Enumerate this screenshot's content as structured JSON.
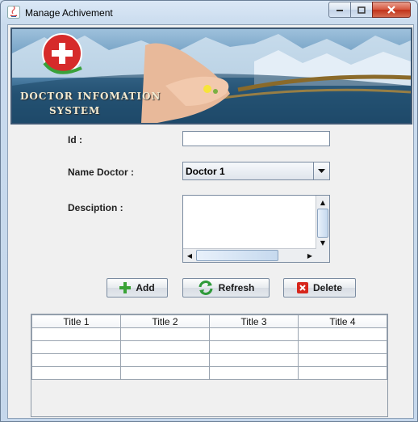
{
  "window": {
    "title": "Manage Achivement"
  },
  "banner": {
    "line1": "DOCTOR INFOMATION",
    "line2": "SYSTEM"
  },
  "form": {
    "id_label": "Id :",
    "id_value": "",
    "doctor_label": "Name Doctor :",
    "doctor_selected": "Doctor 1",
    "description_label": "Desciption :",
    "description_value": ""
  },
  "buttons": {
    "add": "Add",
    "refresh": "Refresh",
    "delete": "Delete"
  },
  "table": {
    "columns": [
      "Title 1",
      "Title 2",
      "Title 3",
      "Title 4"
    ],
    "rows": [
      [
        "",
        "",
        "",
        ""
      ],
      [
        "",
        "",
        "",
        ""
      ],
      [
        "",
        "",
        "",
        ""
      ],
      [
        "",
        "",
        "",
        ""
      ]
    ]
  },
  "colors": {
    "banner_dark": "#1f4a6a",
    "close_red": "#c1321a",
    "add_green": "#3aa336",
    "delete_red": "#d7261c"
  }
}
